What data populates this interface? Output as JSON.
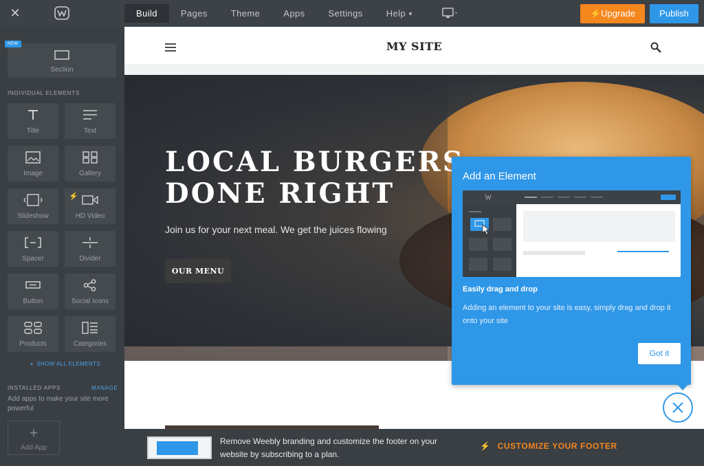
{
  "topbar": {
    "nav": [
      {
        "label": "Build",
        "active": true
      },
      {
        "label": "Pages",
        "active": false
      },
      {
        "label": "Theme",
        "active": false
      },
      {
        "label": "Apps",
        "active": false
      },
      {
        "label": "Settings",
        "active": false
      },
      {
        "label": "Help",
        "active": false,
        "has_caret": true
      }
    ],
    "upgrade_label": "Upgrade",
    "publish_label": "Publish",
    "colors": {
      "upgrade": "#f5871f",
      "publish": "#2f97e8"
    }
  },
  "sidebar": {
    "new_badge": "NEW",
    "section_tile": {
      "label": "Section",
      "icon": "section-icon"
    },
    "individual_heading": "INDIVIDUAL ELEMENTS",
    "elements": [
      {
        "label": "Title",
        "icon": "title-icon"
      },
      {
        "label": "Text",
        "icon": "text-icon"
      },
      {
        "label": "Image",
        "icon": "image-icon"
      },
      {
        "label": "Gallery",
        "icon": "gallery-icon"
      },
      {
        "label": "Slideshow",
        "icon": "slideshow-icon"
      },
      {
        "label": "HD Video",
        "icon": "video-icon",
        "premium": true
      },
      {
        "label": "Spacer",
        "icon": "spacer-icon"
      },
      {
        "label": "Divider",
        "icon": "divider-icon"
      },
      {
        "label": "Button",
        "icon": "button-icon"
      },
      {
        "label": "Social Icons",
        "icon": "share-icon"
      },
      {
        "label": "Products",
        "icon": "products-icon"
      },
      {
        "label": "Categories",
        "icon": "categories-icon"
      }
    ],
    "show_all": "SHOW ALL ELEMENTS",
    "installed_heading": "INSTALLED APPS",
    "manage": "MANAGE",
    "apps_desc": "Add apps to make your site more powerful",
    "add_app": "Add App"
  },
  "site": {
    "title": "MY SITE",
    "hero": {
      "title_line1": "LOCAL BURGERS",
      "title_line2": "DONE RIGHT",
      "subtitle": "Join us for your next meal. We get the juices flowing",
      "button": "OUR MENU"
    }
  },
  "popover": {
    "title": "Add an Element",
    "heading": "Easily drag and drop",
    "body": "Adding an element to your site is easy, simply drag and drop it onto your site",
    "button": "Got it"
  },
  "footer": {
    "text": "Remove Weebly branding and customize the footer on your website by subscribing to a plan.",
    "cta": "CUSTOMIZE YOUR FOOTER"
  }
}
